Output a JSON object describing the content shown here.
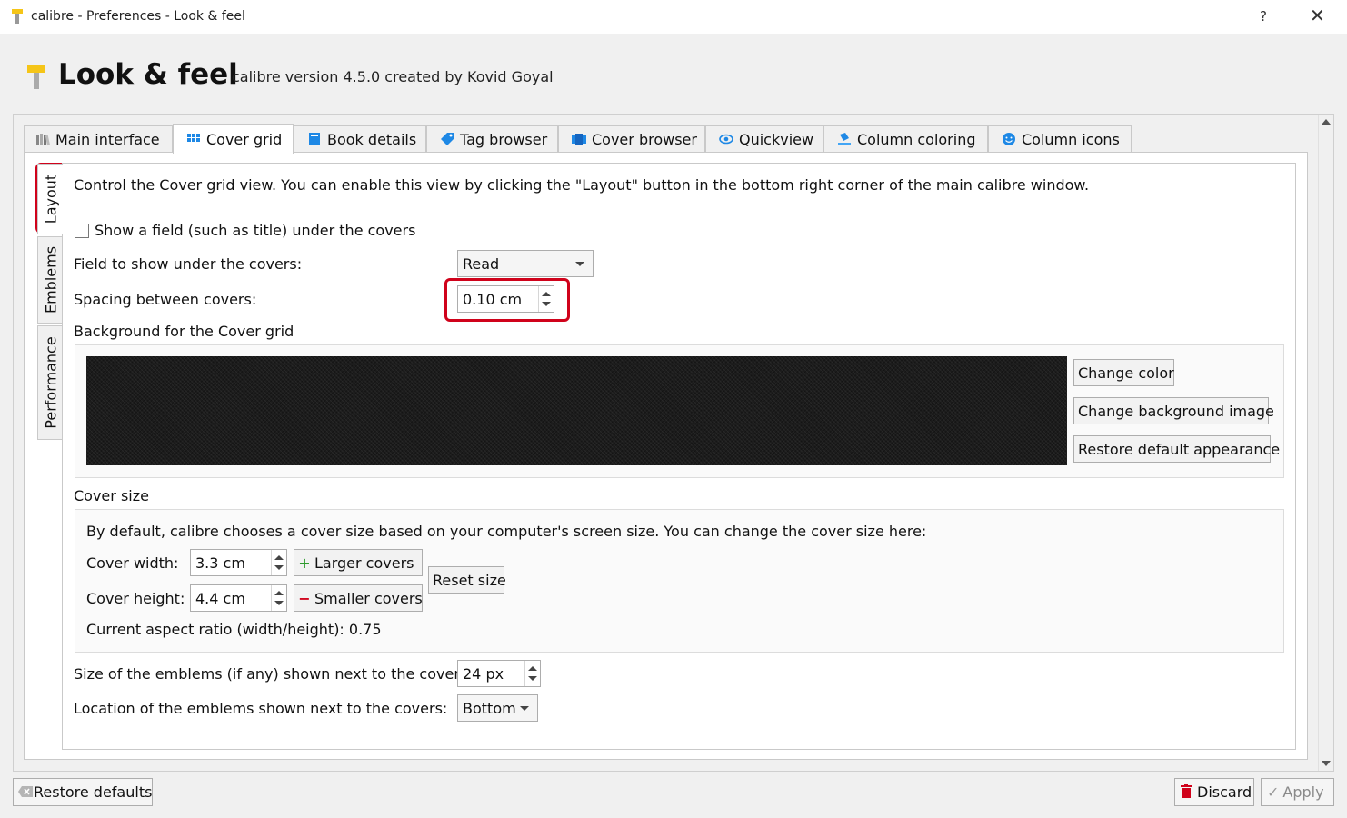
{
  "window": {
    "title": "calibre - Preferences - Look & feel",
    "help_label": "?",
    "close_label": "✕"
  },
  "header": {
    "title": "Look & feel",
    "subtitle": "calibre version 4.5.0 created by Kovid Goyal"
  },
  "tabs": [
    {
      "label": "Main interface",
      "icon": "library-icon",
      "active": false
    },
    {
      "label": "Cover grid",
      "icon": "grid-icon",
      "active": true
    },
    {
      "label": "Book details",
      "icon": "book-icon",
      "active": false
    },
    {
      "label": "Tag browser",
      "icon": "tag-icon",
      "active": false
    },
    {
      "label": "Cover browser",
      "icon": "cover-browser-icon",
      "active": false
    },
    {
      "label": "Quickview",
      "icon": "eye-icon",
      "active": false
    },
    {
      "label": "Column coloring",
      "icon": "paint-bucket-icon",
      "active": false
    },
    {
      "label": "Column icons",
      "icon": "smiley-icon",
      "active": false
    }
  ],
  "side_tabs": [
    {
      "label": "Layout",
      "active": true
    },
    {
      "label": "Emblems",
      "active": false
    },
    {
      "label": "Performance",
      "active": false
    }
  ],
  "layout": {
    "description": "Control the Cover grid view. You can enable this view by clicking the \"Layout\" button in the bottom right corner of the main calibre window.",
    "show_field_label": "Show a field (such as title) under the covers",
    "show_field_checked": false,
    "field_label": "Field to show under the covers:",
    "field_value": "Read",
    "spacing_label": "Spacing between covers:",
    "spacing_value": "0.10 cm",
    "background_section": "Background for the Cover grid",
    "change_color": "Change color",
    "change_background_image": "Change background image",
    "restore_default_appearance": "Restore default appearance",
    "cover_size_section": "Cover size",
    "cover_size_description": "By default, calibre chooses a cover size based on your computer's screen size. You can change the cover size here:",
    "cover_width_label": "Cover width:",
    "cover_width_value": "3.3 cm",
    "cover_height_label": "Cover height:",
    "cover_height_value": "4.4 cm",
    "larger_covers": "Larger covers",
    "smaller_covers": "Smaller covers",
    "reset_size": "Reset size",
    "aspect_ratio": "Current aspect ratio (width/height): 0.75",
    "emblem_size_label": "Size of the emblems (if any) shown next to the covers:",
    "emblem_size_value": "24 px",
    "emblem_location_label": "Location of the emblems shown next to the covers:",
    "emblem_location_value": "Bottom"
  },
  "footer": {
    "restore_defaults": "Restore defaults",
    "discard": "Discard",
    "apply": "Apply"
  },
  "colors": {
    "highlight": "#d0021b",
    "accent_blue": "#1e88e5",
    "calibre_yellow": "#f5c518"
  }
}
